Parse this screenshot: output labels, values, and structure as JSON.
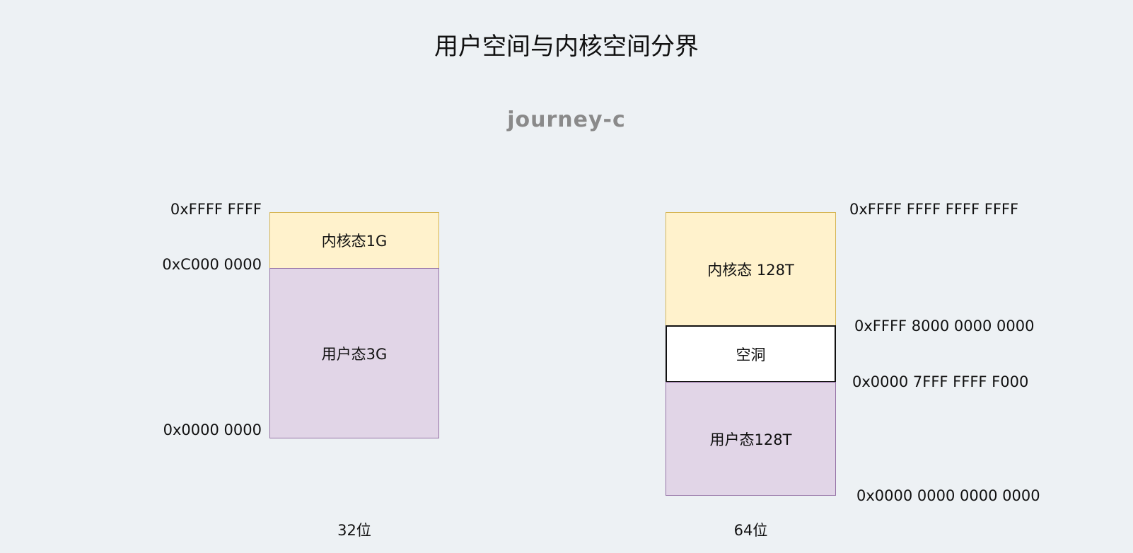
{
  "title": "用户空间与内核空间分界",
  "watermark": "journey-c",
  "diagram32": {
    "caption": "32位",
    "kernel_label": "内核态1G",
    "user_label": "用户态3G",
    "addr_top": "0xFFFF FFFF",
    "addr_boundary": "0xC000 0000",
    "addr_bottom": "0x0000 0000"
  },
  "diagram64": {
    "caption": "64位",
    "kernel_label": "内核态 128T",
    "hole_label": "空洞",
    "user_label": "用户态128T",
    "addr_top": "0xFFFF FFFF FFFF FFFF",
    "addr_kernel_start": "0xFFFF 8000 0000 0000",
    "addr_user_end": "0x0000 7FFF FFFF F000",
    "addr_bottom": "0x0000 0000 0000 0000"
  },
  "colors": {
    "kernel_fill": "#fff2cc",
    "kernel_stroke": "#d6b656",
    "user_fill": "#e1d5e7",
    "user_stroke": "#9673a6",
    "hole_fill": "#ffffff",
    "background": "#edf1f4"
  }
}
